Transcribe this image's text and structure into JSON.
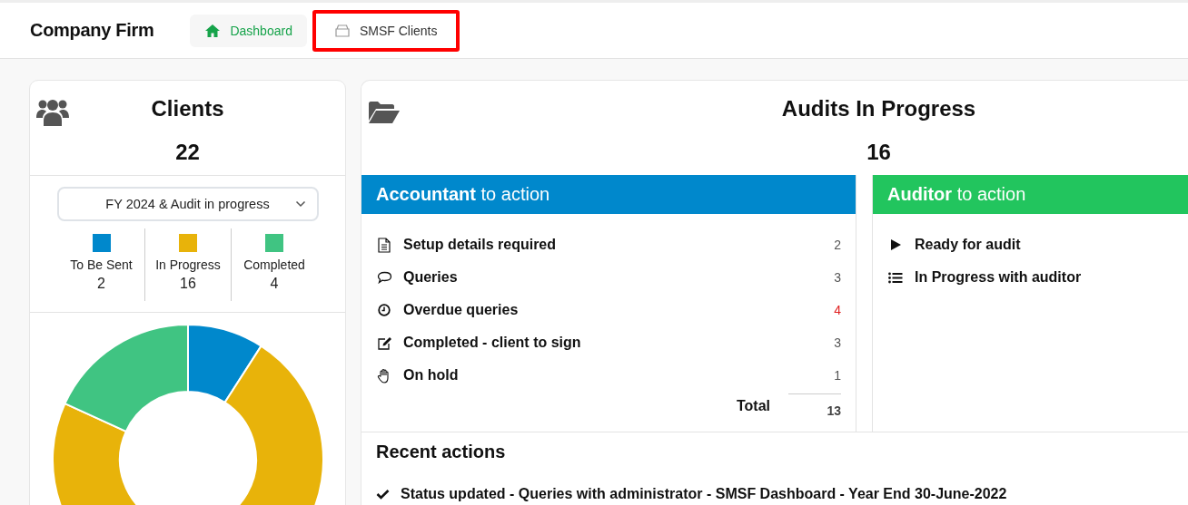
{
  "header": {
    "brand": "Company Firm",
    "nav": [
      {
        "label": "Dashboard",
        "kind": "home",
        "selected": true,
        "highlighted": false
      },
      {
        "label": "SMSF Clients",
        "kind": "tray",
        "selected": false,
        "highlighted": true
      }
    ]
  },
  "clients_card": {
    "title": "Clients",
    "count": "22",
    "filter": {
      "value": "FY 2024 & Audit in progress"
    },
    "legend": [
      {
        "label": "To Be Sent",
        "value": "2",
        "color": "#0088cc"
      },
      {
        "label": "In Progress",
        "value": "16",
        "color": "#e8b30a"
      },
      {
        "label": "Completed",
        "value": "4",
        "color": "#40c482"
      }
    ],
    "chart_data": {
      "type": "donut",
      "values": [
        9.09,
        72.73,
        18.18
      ]
    }
  },
  "audits_card": {
    "title": "Audits In Progress",
    "count": "16",
    "panels": [
      {
        "heading": "**Accountant** to action",
        "color": "#0088cc",
        "items": [
          {
            "kind": "document",
            "label": "Setup details required",
            "count": "2",
            "alert": false
          },
          {
            "kind": "speech",
            "label": "Queries",
            "count": "3",
            "alert": false
          },
          {
            "kind": "clock",
            "label": "Overdue queries",
            "count": "4",
            "alert": true
          },
          {
            "kind": "edit",
            "label": "Completed - client to sign",
            "count": "3",
            "alert": false
          },
          {
            "kind": "hand",
            "label": "On hold",
            "count": "1",
            "alert": false
          }
        ],
        "total_label": "Total",
        "total": "13"
      },
      {
        "heading": "**Auditor** to action",
        "color": "#22c55e",
        "items": [
          {
            "kind": "play",
            "label": "Ready for audit"
          },
          {
            "kind": "list",
            "label": "In Progress with auditor"
          }
        ]
      }
    ]
  },
  "recent_actions": {
    "title": "Recent actions",
    "items": [
      {
        "kind": "check",
        "text": "Status updated - Queries with administrator - SMSF Dashboard - Year End 30-June-2022"
      }
    ]
  }
}
